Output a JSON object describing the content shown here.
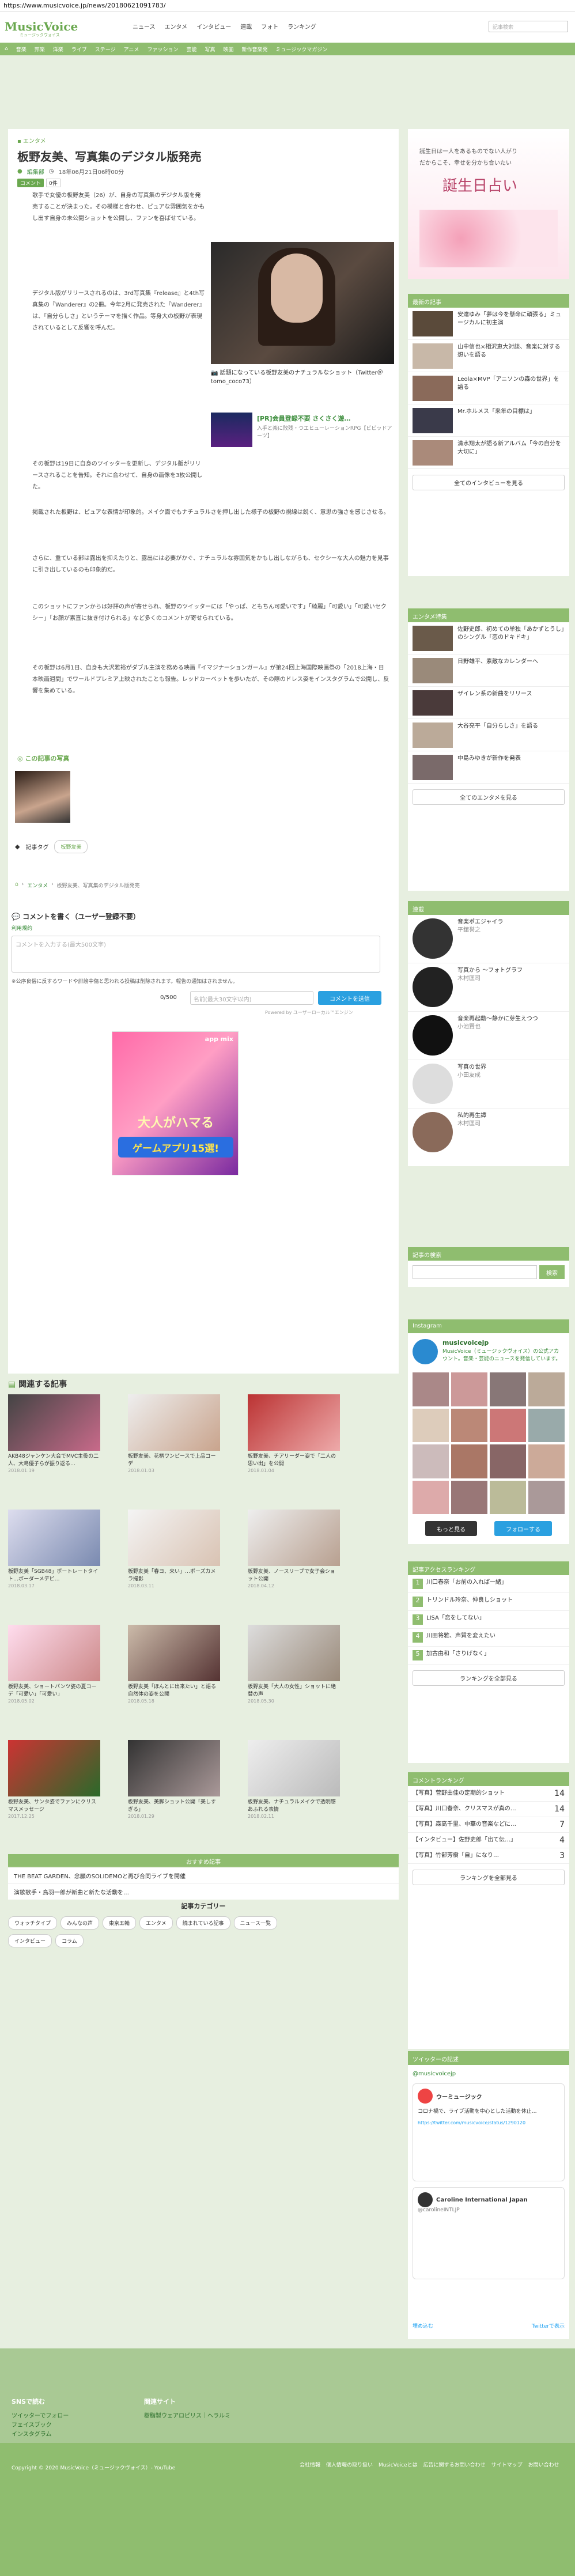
{
  "browser": {
    "url": "https://www.musicvoice.jp/news/20180621091783/"
  },
  "header": {
    "logo": "MusicVoice",
    "logo_sub": "ミュージックヴォイス",
    "nav": [
      "ニュース",
      "エンタメ",
      "インタビュー",
      "連載",
      "フォト",
      "ランキング"
    ],
    "search_placeholder": "記事検索"
  },
  "catnav": [
    "音楽",
    "邦楽",
    "洋楽",
    "ライブ",
    "ステージ",
    "アニメ",
    "ファッション",
    "芸能",
    "写真",
    "映画",
    "新作音楽発",
    "ミュージックマガジン"
  ],
  "article": {
    "category": "エンタメ",
    "title": "板野友美、写真集のデジタル版発売",
    "author": "編集部",
    "date": "18年06月21日06時00分",
    "comment_badge": "コメント",
    "comment_count": "0件",
    "paragraphs": [
      "歌手で女優の板野友美（26）が、自身の写真集のデジタル版を発売することが決まった。その模様と合わせ、ピュアな雰囲気をかもし出す自身の未公開ショットを公開し、ファンを喜ばせている。",
      "デジタル版がリリースされるのは、3rd写真集『release』と4th写真集の『Wanderer』の2冊。今年2月に発売された『Wanderer』は、「自分らしさ」というテーマを描く作品。等身大の板野が表現されているとして反響を呼んだ。",
      "その板野は19日に自身のツイッターを更新し、デジタル版がリリースされることを告知。それに合わせて、自身の画像を3枚公開した。",
      "掲載された板野は、ピュアな表情が印象的。メイク面でもナチュラルさを押し出した様子の板野の視線は鋭く、意思の強さを感じさせる。",
      "さらに、重ている部は露出を抑えたりと、露出には必要がかぐ、ナチュラルな雰囲気をかもし出しながらも、セクシーな大人の魅力を見事に引き出しているのも印象的だ。",
      "このショットにファンからは好評の声が寄せられ、板野のツイッターには「やっぱ、ともちん可愛いです」「綺麗」「可愛い」「可愛いセクシー」「お顔が素直に抜き付けられる」など多くのコメントが寄せられている。",
      "その板野は6月1日、自身も大沢雅裕がダブル主演を務める映画『イマジナーションガール』が第24回上海国際映画祭の「2018上海・日本映画週間」でワールドプレミア上映されたことも報告。レッドカーペットを歩いたが、その際のドレス姿をインスタグラムで公開し、反響を集めている。"
    ],
    "photo_caption": "話題になっている板野友美のナチュラルなショット（Twitter＠tomo_coco73）",
    "pr_title": "[PR]会員登録不要 さくさく遊…",
    "pr_desc": "入手と楽に敗残・つエヒューレーションRPG【ビビッドアーツ】",
    "photos_heading": "この記事の写真",
    "tag_label": "記事タグ",
    "tag": "板野友美",
    "breadcrumb": [
      "エンタメ",
      "板野友美、写真集のデジタル版発売"
    ]
  },
  "comments": {
    "heading": "コメントを書く（ユーザー登録不要）",
    "terms": "利用規約",
    "textarea_placeholder": "コメントを入力する(最大500文字)",
    "notice": "※公序良俗に反するワードや誹謗中傷と思われる投稿は削除されます。報告の通知はされません。",
    "counter": "0/500",
    "name_placeholder": "名前(最大30文字以内)",
    "submit": "コメントを送信",
    "powered": "Powered by ユーザーローカル™エンジン"
  },
  "ad": {
    "brand": "app mix",
    "line1": "大人がハマる",
    "line2": "ゲームアプリ15選!"
  },
  "related": {
    "heading": "関連する記事",
    "items": [
      {
        "caption": "AKB48ジャンケン大会でMVC主役の二人、大島優子らが振り返る…",
        "date": "2018.01.19"
      },
      {
        "caption": "板野友美、花柄ワンピースで上品コーデ",
        "date": "2018.01.03"
      },
      {
        "caption": "板野友美、チアリーダー姿で「二人の思い出」を公開",
        "date": "2018.01.04"
      },
      {
        "caption": "板野友美「SGB48」ポートレートタイト…ボーダーメデビ…",
        "date": "2018.03.17"
      },
      {
        "caption": "板野友美「春ヨ、来い」…ポーズカメラ撮影",
        "date": "2018.03.11"
      },
      {
        "caption": "板野友美、ノースリーブで女子会ショット公開",
        "date": "2018.04.12"
      },
      {
        "caption": "板野友美、ショートパンツ姿の夏コーデ「可愛い」「可愛い」",
        "date": "2018.05.02"
      },
      {
        "caption": "板野友美「ほんとに出来たい」と語る自然体の姿を公開",
        "date": "2018.05.18"
      },
      {
        "caption": "板野友美「大人の女性」ショットに絶賛の声",
        "date": "2018.05.30"
      },
      {
        "caption": "板野友美、サンタ姿でファンにクリスマスメッセージ",
        "date": "2017.12.25"
      },
      {
        "caption": "板野友美、美脚ショット公開「美しすぎる」",
        "date": "2018.01.29"
      },
      {
        "caption": "板野友美、ナチュラルメイクで透明感あふれる表情",
        "date": "2018.02.11"
      }
    ]
  },
  "recommend": {
    "heading": "おすすめ記事",
    "items": [
      "THE BEAT GARDEN、念願のSOLIDEMOと再び合同ライブを開催",
      "演歌歌手・鳥羽一郎が新曲と新たな活動を…"
    ]
  },
  "categories": {
    "heading": "記事カテゴリー",
    "tags": [
      "ウォッチタイプ",
      "みんなの声",
      "東京五輪",
      "エンタメ",
      "読まれている記事",
      "ニュース一覧",
      "インタビュー",
      "コラム"
    ]
  },
  "sidebar": {
    "banner_line1": "誕生日は一人をあるものでない人がり",
    "banner_line2": "だからこそ、幸せを分かち合いたい",
    "banner_title": "誕生日占い",
    "interview_heading": "最新の記事",
    "interview_items": [
      "安達ゆみ「夢は今を懸命に頑張る」ミュージカルに初主演",
      "山中信也×相沢恵大対談、音楽に対する想いを語る",
      "Leola×MVP「アニソンの森の世界」を語る",
      "Mr.ホルメス「来年の目標は」",
      "清水翔太が語る新アルバム「今の自分を大切に」"
    ],
    "interview_more": "全てのインタビューを見る",
    "enta_heading": "エンタメ特集",
    "enta_items": [
      "佐野史郎、初めての単独「あかずとうし」のシングル「恋のドキドキ」",
      "日野雄平、素敵なカレンダーへ",
      "ザイレン系の新曲をリリース",
      "大谷亮平「自分らしさ」を語る",
      "中島みゆきが新作を発表"
    ],
    "enta_more": "全てのエンタメを見る",
    "column_heading": "連載",
    "column_items": [
      {
        "title": "音楽ポエジャイラ",
        "author": "平舘誉之"
      },
      {
        "title": "写真から 〜フォトグラフ",
        "author": "木村匡司"
      },
      {
        "title": "音楽再起動〜静かに芽生えつつ",
        "author": "小池賢也"
      },
      {
        "title": "写真の世界",
        "author": "小田友成"
      },
      {
        "title": "私的再生譚",
        "author": "木村匡司"
      }
    ],
    "search_heading": "記事の検索",
    "search_button": "検索",
    "ig_heading": "Instagram",
    "ig_name": "musicvoicejp",
    "ig_desc": "MusicVoice（ミュージックヴォイス）の公式アカウント。音楽・芸能のニュースを発信しています。",
    "ig_more": "もっと見る",
    "ig_follow": "フォローする",
    "ranking_heading": "記事アクセスランキング",
    "ranking": [
      "川口春奈「お前の入れば一緒」",
      "トリンドル玲奈、仲良しショット",
      "LISA「恋をしてない」",
      "川田将雅、声質を変えたい",
      "加古由和「さりげなく」"
    ],
    "ranking_more": "ランキングを全部見る",
    "comment_heading": "コメントランキング",
    "comment_ranking": [
      {
        "text": "【写真】菅野由佳の定期的ショット",
        "count": "14"
      },
      {
        "text": "【写真】川口春奈、クリスマスが真の…",
        "count": "14"
      },
      {
        "text": "【写真】森高千里、中華の音楽などに…",
        "count": "7"
      },
      {
        "text": "【インタビュー】佐野史郎「出て伝…」",
        "count": "4"
      },
      {
        "text": "【写真】竹部芳樹「自」になり…",
        "count": "3"
      }
    ],
    "comment_more": "ランキングを全部見る",
    "twitter_heading": "ツイッターの記述",
    "tw_handle": "@musicvoicejp",
    "tw_name": "ウーミュージック",
    "tw_text": "コロナ禍で、ライブ活動を中心とした活動を休止…",
    "tw_link": "https://twitter.com/musicvoice/status/1290120",
    "tw_name2": "Caroline International Japan",
    "tw_handle2": "@carolineINTLJP",
    "tw_embed": "埋め込む",
    "tw_view": "Twitterで表示"
  },
  "footer": {
    "sns_heading": "SNSで読む",
    "sns": [
      "ツイッターでフォロー",
      "フェイスブック",
      "インスタグラム"
    ],
    "related_heading": "関連サイト",
    "related_sites": [
      "樹脂製ウェアロピリス｜ヘラルミ"
    ],
    "links": [
      "会社情報",
      "個人情報の取り扱い",
      "MusicVoiceとは",
      "広告に関するお問い合わせ",
      "サイトマップ",
      "お問い合わせ"
    ],
    "copyright": "Copyright © 2020 MusicVoice（ミュージックヴォイス）- YouTube"
  },
  "colors": {
    "accent": "#8fbd6f",
    "bg": "#e7efe0",
    "link": "#3a8c3a"
  }
}
